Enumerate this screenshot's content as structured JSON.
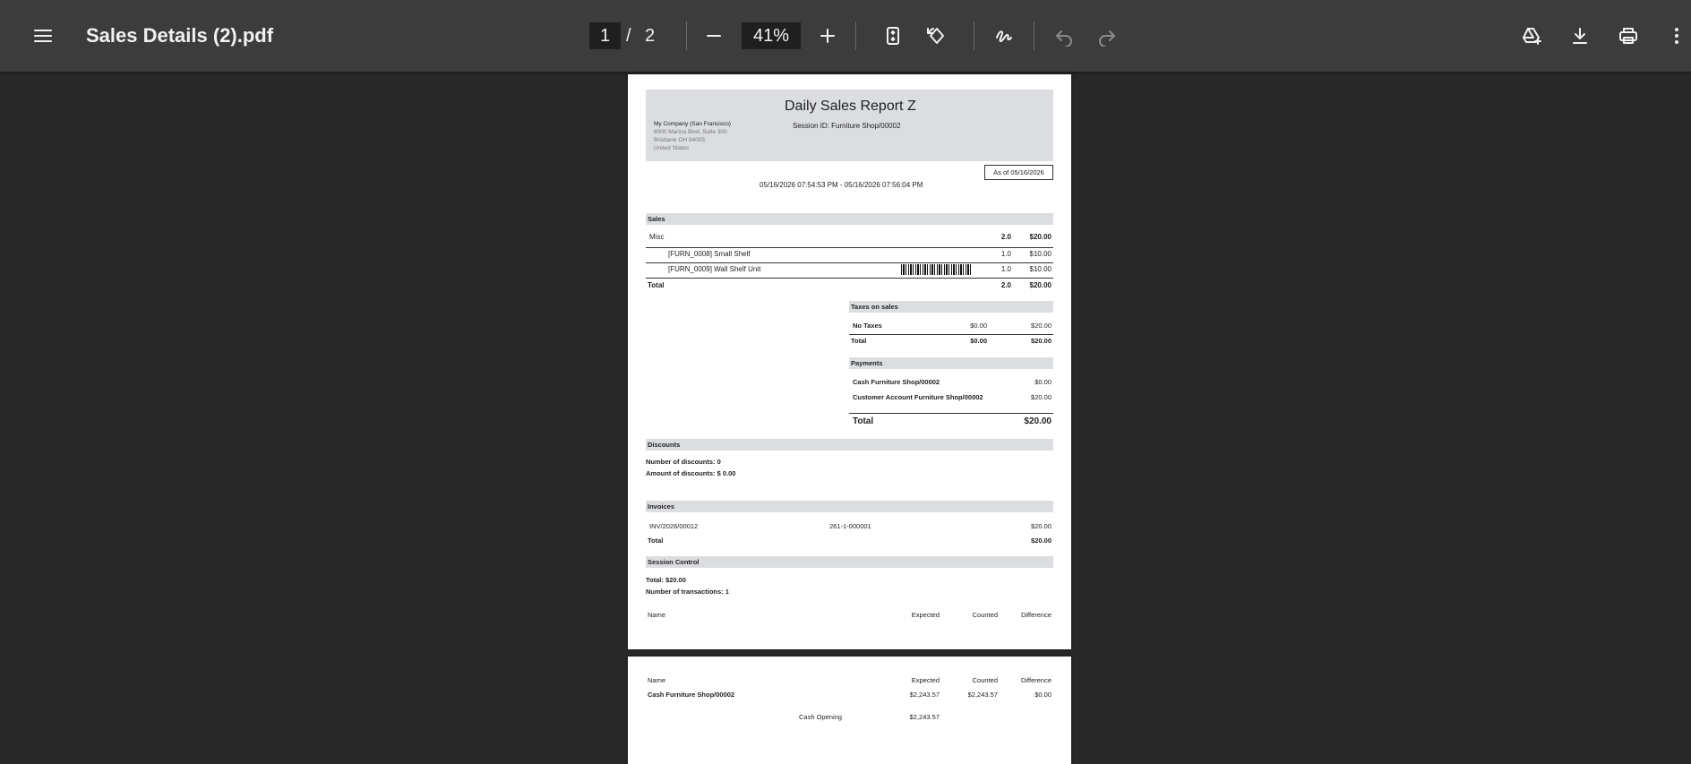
{
  "toolbar": {
    "title": "Sales Details (2).pdf",
    "page_current": "1",
    "page_separator": "/",
    "page_total": "2",
    "zoom": "41%",
    "icons": [
      "menu-icon",
      "zoom-out-icon",
      "zoom-in-icon",
      "fit-page-icon",
      "rotate-icon",
      "draw-icon",
      "undo-icon",
      "redo-icon",
      "drive-add-icon",
      "download-icon",
      "print-icon",
      "more-vert-icon"
    ]
  },
  "report": {
    "title": "Daily Sales Report Z",
    "company": [
      "My Company (San Francisco)",
      "8000 Marina Blvd, Suite 300",
      "Brisbane OH 94005",
      "United States"
    ],
    "session_id": "Session ID: Furniture Shop/00002",
    "as_of": "As of 05/16/2026",
    "date_range": "05/16/2026 07:54:53 PM - 05/16/2026 07:56:04 PM",
    "sales": {
      "header": "Sales",
      "category": "Misc",
      "category_qty": "2.0",
      "category_amount": "$20.00",
      "lines": [
        {
          "name": "[FURN_0008] Small Shelf",
          "qty": "1.0",
          "amount": "$10.00"
        },
        {
          "name": "[FURN_0009] Wall Shelf Unit",
          "qty": "1.0",
          "amount": "$10.00"
        }
      ],
      "total_label": "Total",
      "total_qty": "2.0",
      "total_amount": "$20.00"
    },
    "taxes": {
      "header": "Taxes on sales",
      "row_label": "No Taxes",
      "row_tax": "$0.00",
      "row_base": "$20.00",
      "total_label": "Total",
      "total_tax": "$0.00",
      "total_base": "$20.00"
    },
    "payments": {
      "header": "Payments",
      "rows": [
        {
          "name": "Cash Furniture Shop/00002",
          "amount": "$0.00"
        },
        {
          "name": "Customer Account Furniture Shop/00002",
          "amount": "$20.00"
        }
      ],
      "total_label": "Total",
      "total_amount": "$20.00"
    },
    "discounts": {
      "header": "Discounts",
      "count": "Number of discounts: 0",
      "amount": "Amount of discounts: $ 0.00"
    },
    "invoices": {
      "header": "Invoices",
      "number": "INV/2026/00012",
      "ref": "261-1-000001",
      "amount": "$20.00",
      "total_label": "Total",
      "total_amount": "$20.00"
    },
    "session_control": {
      "header": "Session Control",
      "total": "Total: $20.00",
      "transactions": "Number of transactions: 1",
      "col_name": "Name",
      "col_expected": "Expected",
      "col_counted": "Counted",
      "col_difference": "Difference"
    },
    "page2": {
      "col_name": "Name",
      "col_expected": "Expected",
      "col_counted": "Counted",
      "col_difference": "Difference",
      "row_name": "Cash Furniture Shop/00002",
      "row_expected": "$2,243.57",
      "row_counted": "$2,243.57",
      "row_difference": "$0.00",
      "opening_label": "Cash Opening",
      "opening_amount": "$2,243.57"
    }
  }
}
